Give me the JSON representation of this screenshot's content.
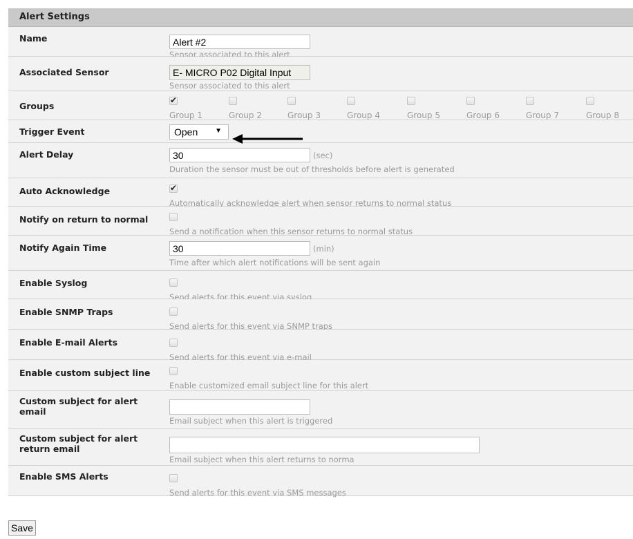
{
  "header": {
    "title": "Alert Settings"
  },
  "name": {
    "label": "Name",
    "value": "Alert #2",
    "help": "Sensor associated to this alert"
  },
  "sensor": {
    "label": "Associated Sensor",
    "value": "E- MICRO P02 Digital Input",
    "help": "Sensor associated to this alert"
  },
  "groups": {
    "label": "Groups",
    "items": [
      {
        "label": "Group 1",
        "checked": true
      },
      {
        "label": "Group 2",
        "checked": false
      },
      {
        "label": "Group 3",
        "checked": false
      },
      {
        "label": "Group 4",
        "checked": false
      },
      {
        "label": "Group 5",
        "checked": false
      },
      {
        "label": "Group 6",
        "checked": false
      },
      {
        "label": "Group 7",
        "checked": false
      },
      {
        "label": "Group 8",
        "checked": false
      }
    ]
  },
  "trigger": {
    "label": "Trigger Event",
    "selected": "Open"
  },
  "alert_delay": {
    "label": "Alert Delay",
    "value": "30",
    "unit": "(sec)",
    "help": "Duration the sensor must be out of thresholds before alert is generated"
  },
  "auto_ack": {
    "label": "Auto Acknowledge",
    "checked": true,
    "help": "Automatically acknowledge alert when sensor returns to normal status"
  },
  "notify_return": {
    "label": "Notify on return to normal",
    "checked": false,
    "help": "Send a notification when this sensor returns to normal status"
  },
  "notify_again": {
    "label": "Notify Again Time",
    "value": "30",
    "unit": "(min)",
    "help": "Time after which alert notifications will be sent again"
  },
  "syslog": {
    "label": "Enable Syslog",
    "checked": false,
    "help": "Send alerts for this event via syslog"
  },
  "snmp": {
    "label": "Enable SNMP Traps",
    "checked": false,
    "help": "Send alerts for this event via SNMP traps"
  },
  "email": {
    "label": "Enable E-mail Alerts",
    "checked": false,
    "help": "Send alerts for this event via e-mail"
  },
  "custom_subject_enable": {
    "label": "Enable custom subject line",
    "checked": false,
    "help": "Enable customized email subject line for this alert"
  },
  "custom_subject": {
    "label": "Custom subject for alert email",
    "value": "",
    "help": "Email subject when this alert is triggered"
  },
  "custom_return_subject": {
    "label": "Custom subject for alert return email",
    "value": "",
    "help": "Email subject when this alert returns to norma"
  },
  "sms": {
    "label": "Enable SMS Alerts",
    "checked": false,
    "help": "Send alerts for this event via SMS messages"
  },
  "save": {
    "label": "Save"
  }
}
